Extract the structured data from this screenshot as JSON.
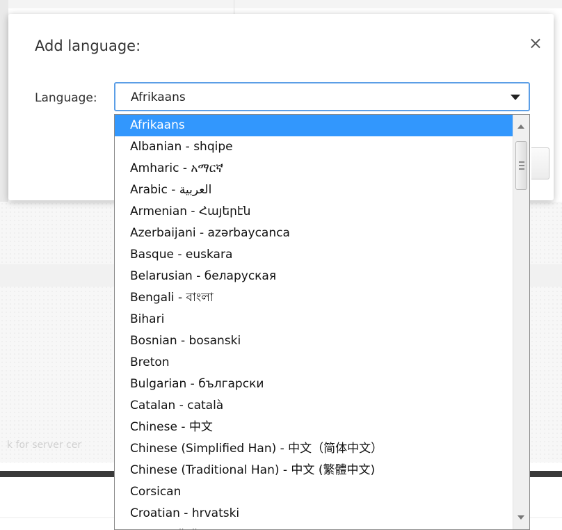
{
  "background": {
    "faint_text": "k for server cer"
  },
  "dialog": {
    "title": "Add language:",
    "close_label": "×",
    "language_label": "Language",
    "selected_value": "Afrikaans"
  },
  "dropdown": {
    "items": [
      "Afrikaans",
      "Albanian - shqipe",
      "Amharic - አማርኛ",
      "Arabic - العربية",
      "Armenian - Հայերէն",
      "Azerbaijani - azərbaycanca",
      "Basque - euskara",
      "Belarusian - беларуская",
      "Bengali - বাংলা",
      "Bihari",
      "Bosnian - bosanski",
      "Breton",
      "Bulgarian - български",
      "Catalan - català",
      "Chinese - 中文",
      "Chinese (Simplified Han) - 中文（简体中文）",
      "Chinese (Traditional Han) - 中文 (繁體中文)",
      "Corsican",
      "Croatian - hrvatski",
      "Czech - čeština"
    ],
    "selected_index": 0
  },
  "colors": {
    "selection": "#3297fd",
    "focus_border": "#5b9ee6"
  }
}
